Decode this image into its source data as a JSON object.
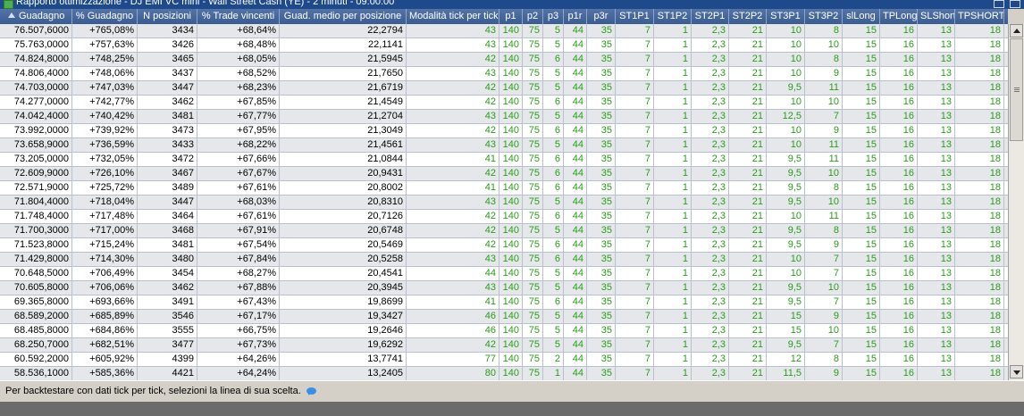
{
  "window": {
    "title": "Rapporto ottimizzazione - DJ EMI VC mini - Wall Street Cash (YE) - 2 minuti - 09:00:00"
  },
  "columns": [
    "Guadagno",
    "% Guadagno",
    "N posizioni",
    "% Trade vincenti",
    "Guad. medio per posizione",
    "Modalità tick per tick",
    "p1",
    "p2",
    "p3",
    "p1r",
    "p3r",
    "ST1P1",
    "ST1P2",
    "ST2P1",
    "ST2P2",
    "ST3P1",
    "ST3P2",
    "slLong",
    "TPLong",
    "SLShort",
    "TPSHORT"
  ],
  "rows": [
    [
      "76.507,6000",
      "+765,08%",
      "3434",
      "+68,64%",
      "22,2794",
      "43",
      "140",
      "75",
      "5",
      "44",
      "35",
      "7",
      "1",
      "2,3",
      "21",
      "10",
      "8",
      "15",
      "16",
      "13",
      "18"
    ],
    [
      "75.763,0000",
      "+757,63%",
      "3426",
      "+68,48%",
      "22,1141",
      "43",
      "140",
      "75",
      "5",
      "44",
      "35",
      "7",
      "1",
      "2,3",
      "21",
      "10",
      "10",
      "15",
      "16",
      "13",
      "18"
    ],
    [
      "74.824,8000",
      "+748,25%",
      "3465",
      "+68,05%",
      "21,5945",
      "42",
      "140",
      "75",
      "6",
      "44",
      "35",
      "7",
      "1",
      "2,3",
      "21",
      "10",
      "8",
      "15",
      "16",
      "13",
      "18"
    ],
    [
      "74.806,4000",
      "+748,06%",
      "3437",
      "+68,52%",
      "21,7650",
      "43",
      "140",
      "75",
      "5",
      "44",
      "35",
      "7",
      "1",
      "2,3",
      "21",
      "10",
      "9",
      "15",
      "16",
      "13",
      "18"
    ],
    [
      "74.703,0000",
      "+747,03%",
      "3447",
      "+68,23%",
      "21,6719",
      "42",
      "140",
      "75",
      "5",
      "44",
      "35",
      "7",
      "1",
      "2,3",
      "21",
      "9,5",
      "11",
      "15",
      "16",
      "13",
      "18"
    ],
    [
      "74.277,0000",
      "+742,77%",
      "3462",
      "+67,85%",
      "21,4549",
      "42",
      "140",
      "75",
      "6",
      "44",
      "35",
      "7",
      "1",
      "2,3",
      "21",
      "10",
      "10",
      "15",
      "16",
      "13",
      "18"
    ],
    [
      "74.042,4000",
      "+740,42%",
      "3481",
      "+67,77%",
      "21,2704",
      "43",
      "140",
      "75",
      "5",
      "44",
      "35",
      "7",
      "1",
      "2,3",
      "21",
      "12,5",
      "7",
      "15",
      "16",
      "13",
      "18"
    ],
    [
      "73.992,0000",
      "+739,92%",
      "3473",
      "+67,95%",
      "21,3049",
      "42",
      "140",
      "75",
      "6",
      "44",
      "35",
      "7",
      "1",
      "2,3",
      "21",
      "10",
      "9",
      "15",
      "16",
      "13",
      "18"
    ],
    [
      "73.658,9000",
      "+736,59%",
      "3433",
      "+68,22%",
      "21,4561",
      "43",
      "140",
      "75",
      "5",
      "44",
      "35",
      "7",
      "1",
      "2,3",
      "21",
      "10",
      "11",
      "15",
      "16",
      "13",
      "18"
    ],
    [
      "73.205,0000",
      "+732,05%",
      "3472",
      "+67,66%",
      "21,0844",
      "41",
      "140",
      "75",
      "6",
      "44",
      "35",
      "7",
      "1",
      "2,3",
      "21",
      "9,5",
      "11",
      "15",
      "16",
      "13",
      "18"
    ],
    [
      "72.609,9000",
      "+726,10%",
      "3467",
      "+67,67%",
      "20,9431",
      "42",
      "140",
      "75",
      "6",
      "44",
      "35",
      "7",
      "1",
      "2,3",
      "21",
      "9,5",
      "10",
      "15",
      "16",
      "13",
      "18"
    ],
    [
      "72.571,9000",
      "+725,72%",
      "3489",
      "+67,61%",
      "20,8002",
      "41",
      "140",
      "75",
      "6",
      "44",
      "35",
      "7",
      "1",
      "2,3",
      "21",
      "9,5",
      "8",
      "15",
      "16",
      "13",
      "18"
    ],
    [
      "71.804,4000",
      "+718,04%",
      "3447",
      "+68,03%",
      "20,8310",
      "43",
      "140",
      "75",
      "5",
      "44",
      "35",
      "7",
      "1",
      "2,3",
      "21",
      "9,5",
      "10",
      "15",
      "16",
      "13",
      "18"
    ],
    [
      "71.748,4000",
      "+717,48%",
      "3464",
      "+67,61%",
      "20,7126",
      "42",
      "140",
      "75",
      "6",
      "44",
      "35",
      "7",
      "1",
      "2,3",
      "21",
      "10",
      "11",
      "15",
      "16",
      "13",
      "18"
    ],
    [
      "71.700,3000",
      "+717,00%",
      "3468",
      "+67,91%",
      "20,6748",
      "42",
      "140",
      "75",
      "5",
      "44",
      "35",
      "7",
      "1",
      "2,3",
      "21",
      "9,5",
      "8",
      "15",
      "16",
      "13",
      "18"
    ],
    [
      "71.523,8000",
      "+715,24%",
      "3481",
      "+67,54%",
      "20,5469",
      "42",
      "140",
      "75",
      "6",
      "44",
      "35",
      "7",
      "1",
      "2,3",
      "21",
      "9,5",
      "9",
      "15",
      "16",
      "13",
      "18"
    ],
    [
      "71.429,8000",
      "+714,30%",
      "3480",
      "+67,84%",
      "20,5258",
      "43",
      "140",
      "75",
      "6",
      "44",
      "35",
      "7",
      "1",
      "2,3",
      "21",
      "10",
      "7",
      "15",
      "16",
      "13",
      "18"
    ],
    [
      "70.648,5000",
      "+706,49%",
      "3454",
      "+68,27%",
      "20,4541",
      "44",
      "140",
      "75",
      "5",
      "44",
      "35",
      "7",
      "1",
      "2,3",
      "21",
      "10",
      "7",
      "15",
      "16",
      "13",
      "18"
    ],
    [
      "70.605,8000",
      "+706,06%",
      "3462",
      "+67,88%",
      "20,3945",
      "43",
      "140",
      "75",
      "5",
      "44",
      "35",
      "7",
      "1",
      "2,3",
      "21",
      "9,5",
      "10",
      "15",
      "16",
      "13",
      "18"
    ],
    [
      "69.365,8000",
      "+693,66%",
      "3491",
      "+67,43%",
      "19,8699",
      "41",
      "140",
      "75",
      "6",
      "44",
      "35",
      "7",
      "1",
      "2,3",
      "21",
      "9,5",
      "7",
      "15",
      "16",
      "13",
      "18"
    ],
    [
      "68.589,2000",
      "+685,89%",
      "3546",
      "+67,17%",
      "19,3427",
      "46",
      "140",
      "75",
      "5",
      "44",
      "35",
      "7",
      "1",
      "2,3",
      "21",
      "15",
      "9",
      "15",
      "16",
      "13",
      "18"
    ],
    [
      "68.485,8000",
      "+684,86%",
      "3555",
      "+66,75%",
      "19,2646",
      "46",
      "140",
      "75",
      "5",
      "44",
      "35",
      "7",
      "1",
      "2,3",
      "21",
      "15",
      "10",
      "15",
      "16",
      "13",
      "18"
    ],
    [
      "68.250,7000",
      "+682,51%",
      "3477",
      "+67,73%",
      "19,6292",
      "42",
      "140",
      "75",
      "5",
      "44",
      "35",
      "7",
      "1",
      "2,3",
      "21",
      "9,5",
      "7",
      "15",
      "16",
      "13",
      "18"
    ],
    [
      "60.592,2000",
      "+605,92%",
      "4399",
      "+64,26%",
      "13,7741",
      "77",
      "140",
      "75",
      "2",
      "44",
      "35",
      "7",
      "1",
      "2,3",
      "21",
      "12",
      "8",
      "15",
      "16",
      "13",
      "18"
    ],
    [
      "58.536,1000",
      "+585,36%",
      "4421",
      "+64,24%",
      "13,2405",
      "80",
      "140",
      "75",
      "1",
      "44",
      "35",
      "7",
      "1",
      "2,3",
      "21",
      "11,5",
      "9",
      "15",
      "16",
      "13",
      "18"
    ]
  ],
  "status": {
    "text": "Per backtestare con dati tick per tick, selezioni la linea di sua scelta."
  },
  "colors": {
    "header": "#3b5c90",
    "value_green": "#2a9d1a",
    "row_alt": "#e5e7ea"
  },
  "icons": {
    "sort": "sort-asc-icon",
    "status": "speech-bubble-icon",
    "window": "app-icon"
  }
}
